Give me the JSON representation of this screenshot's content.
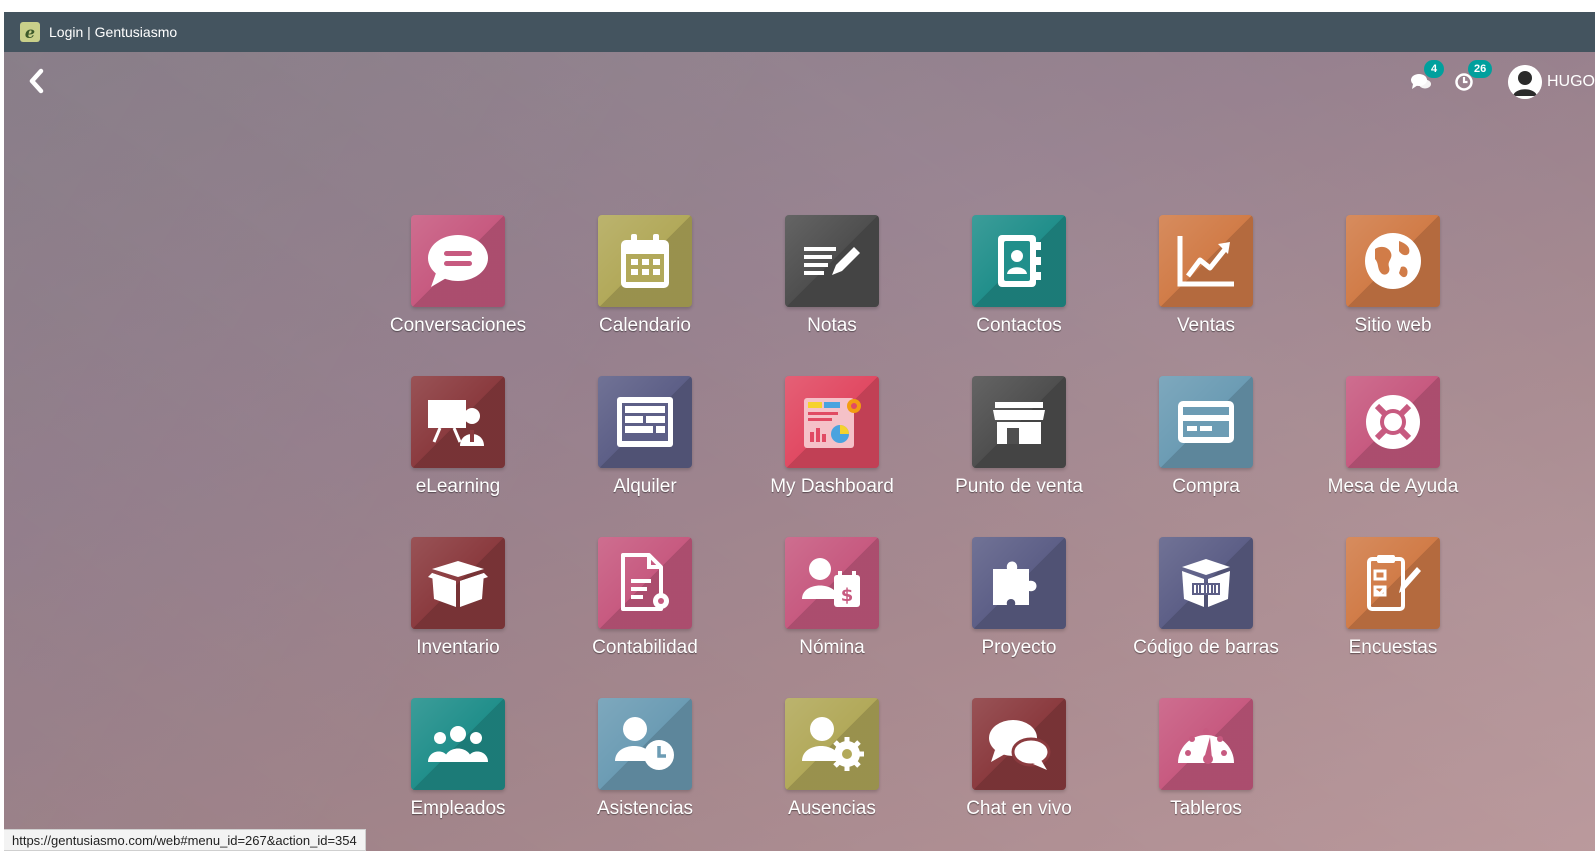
{
  "window": {
    "title": "Login | Gentusiasmo",
    "favicon_letter": "e"
  },
  "topbar": {
    "back_icon": "chevron-left-icon",
    "messages": {
      "icon": "chat-bubbles-icon",
      "count": "4"
    },
    "activities": {
      "icon": "clock-icon",
      "count": "26"
    },
    "user": {
      "name": "HUGO",
      "icon": "user-avatar-icon"
    }
  },
  "accent_color": "#00a09d",
  "apps": [
    {
      "label": "Conversaciones",
      "icon": "chat-icon",
      "color": "#c75a80"
    },
    {
      "label": "Calendario",
      "icon": "calendar-icon",
      "color": "#b2a95a"
    },
    {
      "label": "Notas",
      "icon": "notes-icon",
      "color": "#4f4f4f"
    },
    {
      "label": "Contactos",
      "icon": "address-book-icon",
      "color": "#218f8b"
    },
    {
      "label": "Ventas",
      "icon": "sales-chart-icon",
      "color": "#d17c48"
    },
    {
      "label": "Sitio web",
      "icon": "globe-icon",
      "color": "#d17c48"
    },
    {
      "label": "eLearning",
      "icon": "presentation-icon",
      "color": "#8b3b3f"
    },
    {
      "label": "Alquiler",
      "icon": "rental-table-icon",
      "color": "#5d5f87"
    },
    {
      "label": "My Dashboard",
      "icon": "dashboard-icon",
      "color": "#e14a63"
    },
    {
      "label": "Punto de venta",
      "icon": "store-icon",
      "color": "#4f4f4f"
    },
    {
      "label": "Compra",
      "icon": "credit-card-icon",
      "color": "#6c9cb4"
    },
    {
      "label": "Mesa de Ayuda",
      "icon": "lifebuoy-icon",
      "color": "#c75a80"
    },
    {
      "label": "Inventario",
      "icon": "box-icon",
      "color": "#8b3b3f"
    },
    {
      "label": "Contabilidad",
      "icon": "accounting-document-icon",
      "color": "#c75a80"
    },
    {
      "label": "Nómina",
      "icon": "payroll-icon",
      "color": "#c75a80"
    },
    {
      "label": "Proyecto",
      "icon": "puzzle-icon",
      "color": "#5d5f87"
    },
    {
      "label": "Código de barras",
      "icon": "barcode-box-icon",
      "color": "#5d5f87"
    },
    {
      "label": "Encuestas",
      "icon": "survey-icon",
      "color": "#d17c48"
    },
    {
      "label": "Empleados",
      "icon": "people-icon",
      "color": "#218f8b"
    },
    {
      "label": "Asistencias",
      "icon": "attendance-icon",
      "color": "#6c9cb4"
    },
    {
      "label": "Ausencias",
      "icon": "leave-icon",
      "color": "#b2a95a"
    },
    {
      "label": "Chat en vivo",
      "icon": "live-chat-icon",
      "color": "#8b3b3f"
    },
    {
      "label": "Tableros",
      "icon": "gauge-icon",
      "color": "#c75a80"
    }
  ],
  "statusbar": {
    "url": "https://gentusiasmo.com/web#menu_id=267&action_id=354"
  }
}
